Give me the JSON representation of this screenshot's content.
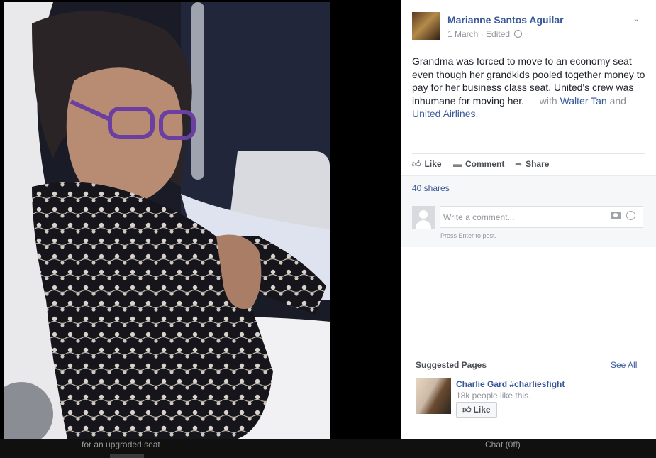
{
  "post": {
    "author": "Marianne Santos Aguilar",
    "date": "1 March",
    "edited": "Edited",
    "text": "Grandma was forced to move to an economy seat even though her grandkids pooled together money to pay for her business class seat. United's crew was inhumane for moving her.",
    "with_prefix": " — with ",
    "tag1": "Walter Tan",
    "and": " and ",
    "tag2": "United Airlines",
    "period": "."
  },
  "actions": {
    "like": "Like",
    "comment": "Comment",
    "share": "Share"
  },
  "shares": "40 shares",
  "comment_box": {
    "placeholder": "Write a comment...",
    "hint": "Press Enter to post."
  },
  "suggested": {
    "title": "Suggested Pages",
    "see_all": "See All",
    "page_name": "Charlie Gard #charliesfight",
    "page_likes": "18k people like this.",
    "like_button": "Like"
  },
  "bottom_strip": {
    "left_text": "for an upgraded seat",
    "right_text": "Chat (0ff)"
  },
  "icons": {
    "like": "thumbs-up-icon",
    "comment": "speech-bubble-icon",
    "share": "share-arrow-icon",
    "globe": "globe-icon",
    "camera": "camera-icon",
    "emoji": "smiley-icon",
    "chevron": "chevron-down-icon"
  },
  "colors": {
    "link": "#365899",
    "text": "#1d2129",
    "muted": "#90949c",
    "lightbox_bg": "#000000"
  }
}
